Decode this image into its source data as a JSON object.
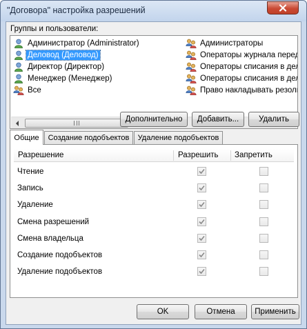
{
  "window": {
    "title": "\"Договора\" настройка разрешений"
  },
  "groups": {
    "label": "Группы и пользователи:",
    "left_items": [
      {
        "label": "Администратор (Administrator)",
        "icon": "user-icon",
        "selected": false
      },
      {
        "label": "Деловод (Деловод)",
        "icon": "user-icon",
        "selected": true
      },
      {
        "label": "Директор (Директор)",
        "icon": "user-icon",
        "selected": false
      },
      {
        "label": "Менеджер (Менеджер)",
        "icon": "user-icon",
        "selected": false
      },
      {
        "label": "Все",
        "icon": "group-icon",
        "selected": false
      }
    ],
    "right_items": [
      {
        "label": "Администраторы",
        "icon": "group-icon"
      },
      {
        "label": "Операторы журнала передач",
        "icon": "group-icon"
      },
      {
        "label": "Операторы списания в дело",
        "icon": "group-icon"
      },
      {
        "label": "Операторы списания в дело",
        "icon": "group-icon"
      },
      {
        "label": "Право накладывать резолюции",
        "icon": "group-icon"
      }
    ],
    "scroll_thumb_glyph": "|||"
  },
  "buttons": {
    "advanced": "Дополнительно",
    "add": "Добавить...",
    "remove": "Удалить",
    "ok": "OK",
    "cancel": "Отмена",
    "apply": "Применить"
  },
  "tabs": [
    {
      "label": "Общие",
      "active": true
    },
    {
      "label": "Создание подобъектов",
      "active": false
    },
    {
      "label": "Удаление подобъектов",
      "active": false
    }
  ],
  "permissions": {
    "headers": {
      "name": "Разрешение",
      "allow": "Разрешить",
      "deny": "Запретить"
    },
    "rows": [
      {
        "name": "Чтение",
        "allow": true,
        "deny": false
      },
      {
        "name": "Запись",
        "allow": true,
        "deny": false
      },
      {
        "name": "Удаление",
        "allow": true,
        "deny": false
      },
      {
        "name": "Смена разрешений",
        "allow": true,
        "deny": false
      },
      {
        "name": "Смена владельца",
        "allow": true,
        "deny": false
      },
      {
        "name": "Создание подобъектов",
        "allow": true,
        "deny": false
      },
      {
        "name": "Удаление подобъектов",
        "allow": true,
        "deny": false
      }
    ]
  },
  "colors": {
    "selection": "#3399ff",
    "title_bar": "#c2d4ec",
    "close_button": "#c94a34",
    "disabled_check": "#8a8a8a"
  }
}
